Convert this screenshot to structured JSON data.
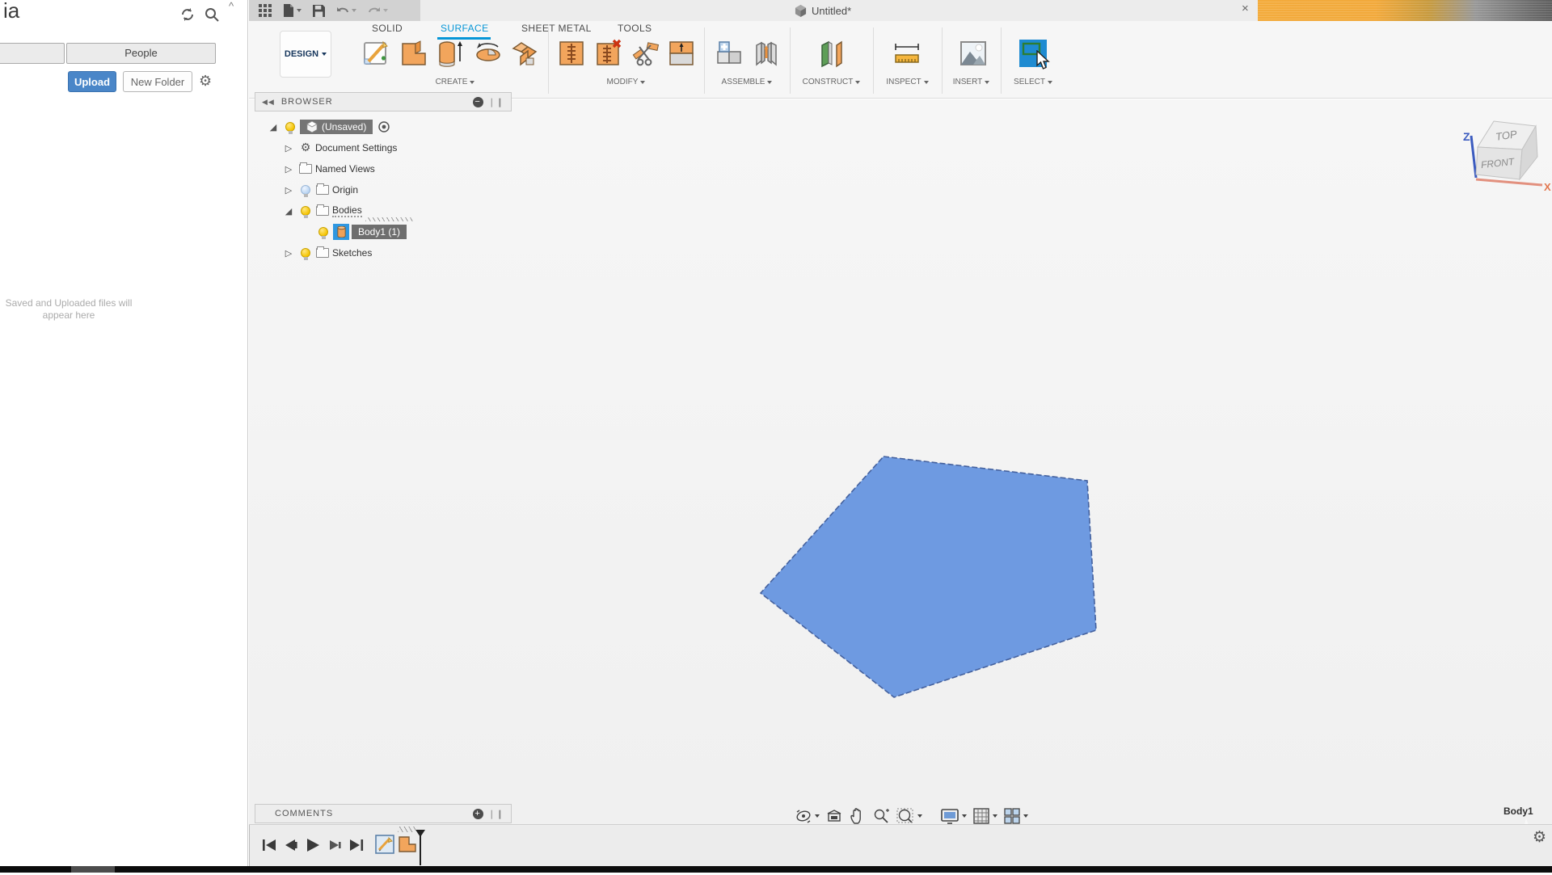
{
  "data_panel": {
    "title": "ia",
    "people_tab": "People",
    "upload_label": "Upload",
    "new_folder_label": "New Folder",
    "empty_message": "Saved and Uploaded files will appear here",
    "collapse_glyph": "^"
  },
  "titlebar": {
    "document_title": "Untitled*",
    "close_glyph": "×"
  },
  "ribbon": {
    "workspace_label": "DESIGN",
    "tabs": [
      "SOLID",
      "SURFACE",
      "SHEET METAL",
      "TOOLS"
    ],
    "active_tab": "SURFACE",
    "groups": [
      "CREATE",
      "MODIFY",
      "ASSEMBLE",
      "CONSTRUCT",
      "INSPECT",
      "INSERT",
      "SELECT"
    ]
  },
  "browser": {
    "title": "BROWSER",
    "collapse_glyph": "◀◀",
    "minimize_glyph": "−",
    "grip_glyph": "❘❙",
    "rows": [
      {
        "label": "(Unsaved)"
      },
      {
        "label": "Document Settings"
      },
      {
        "label": "Named Views"
      },
      {
        "label": "Origin"
      },
      {
        "label": "Bodies"
      },
      {
        "label": "Body1 (1)"
      },
      {
        "label": "Sketches"
      }
    ]
  },
  "viewcube": {
    "top_label": "TOP",
    "front_label": "FRONT",
    "axis_z": "Z",
    "axis_x": "X"
  },
  "viewport": {
    "selection_label": "Body1",
    "pentagon_fill": "#6e9ae1",
    "pentagon_stroke": "#44619e"
  },
  "comments": {
    "title": "COMMENTS",
    "add_glyph": "+",
    "grip_glyph": "❘❙"
  },
  "glyphs": {
    "gear": "⚙",
    "expanded": "◢",
    "collapsed": "▷"
  },
  "colors": {
    "accent_blue": "#0696d7",
    "upload_blue": "#4a86c8",
    "select_highlight": "#1e8bd1",
    "body_orange": "#f0a159"
  }
}
